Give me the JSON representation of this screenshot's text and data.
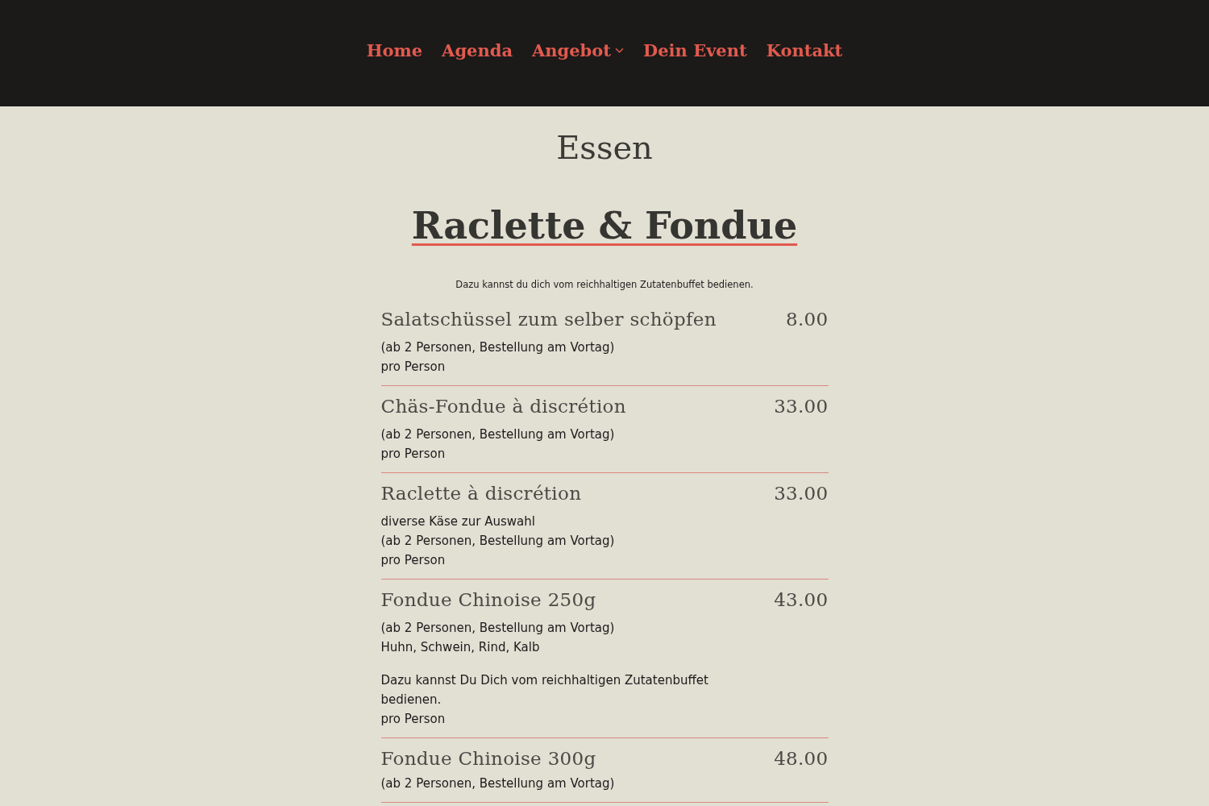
{
  "nav": {
    "items": [
      {
        "label": "Home",
        "has_submenu": false
      },
      {
        "label": "Agenda",
        "has_submenu": false
      },
      {
        "label": "Angebot",
        "has_submenu": true
      },
      {
        "label": "Dein Event",
        "has_submenu": false
      },
      {
        "label": "Kontakt",
        "has_submenu": false
      }
    ]
  },
  "page_title": "Essen",
  "section": {
    "title": "Raclette & Fondue",
    "intro": "Dazu kannst du dich vom reichhaltigen Zutatenbuffet bedienen.",
    "items": [
      {
        "name": "Salatschüssel zum selber schöpfen",
        "price": "8.00",
        "paragraphs": [
          [
            "(ab 2 Personen, Bestellung am Vortag)",
            "pro Person"
          ]
        ]
      },
      {
        "name": "Chäs-Fondue à discrétion",
        "price": "33.00",
        "paragraphs": [
          [
            "(ab 2 Personen, Bestellung am Vortag)",
            "pro Person"
          ]
        ]
      },
      {
        "name": "Raclette à discrétion",
        "price": "33.00",
        "paragraphs": [
          [
            "diverse Käse zur Auswahl",
            "(ab 2 Personen, Bestellung am Vortag)",
            "pro Person"
          ]
        ]
      },
      {
        "name": "Fondue Chinoise 250g",
        "price": "43.00",
        "paragraphs": [
          [
            "(ab 2 Personen, Bestellung am Vortag)",
            "Huhn, Schwein, Rind, Kalb"
          ],
          [
            "Dazu kannst Du Dich vom reichhaltigen Zutatenbuffet bedienen.",
            "pro Person"
          ]
        ]
      },
      {
        "name": "Fondue Chinoise 300g",
        "price": "48.00",
        "paragraphs": [
          [
            "(ab 2 Personen, Bestellung am Vortag)"
          ]
        ]
      }
    ]
  }
}
